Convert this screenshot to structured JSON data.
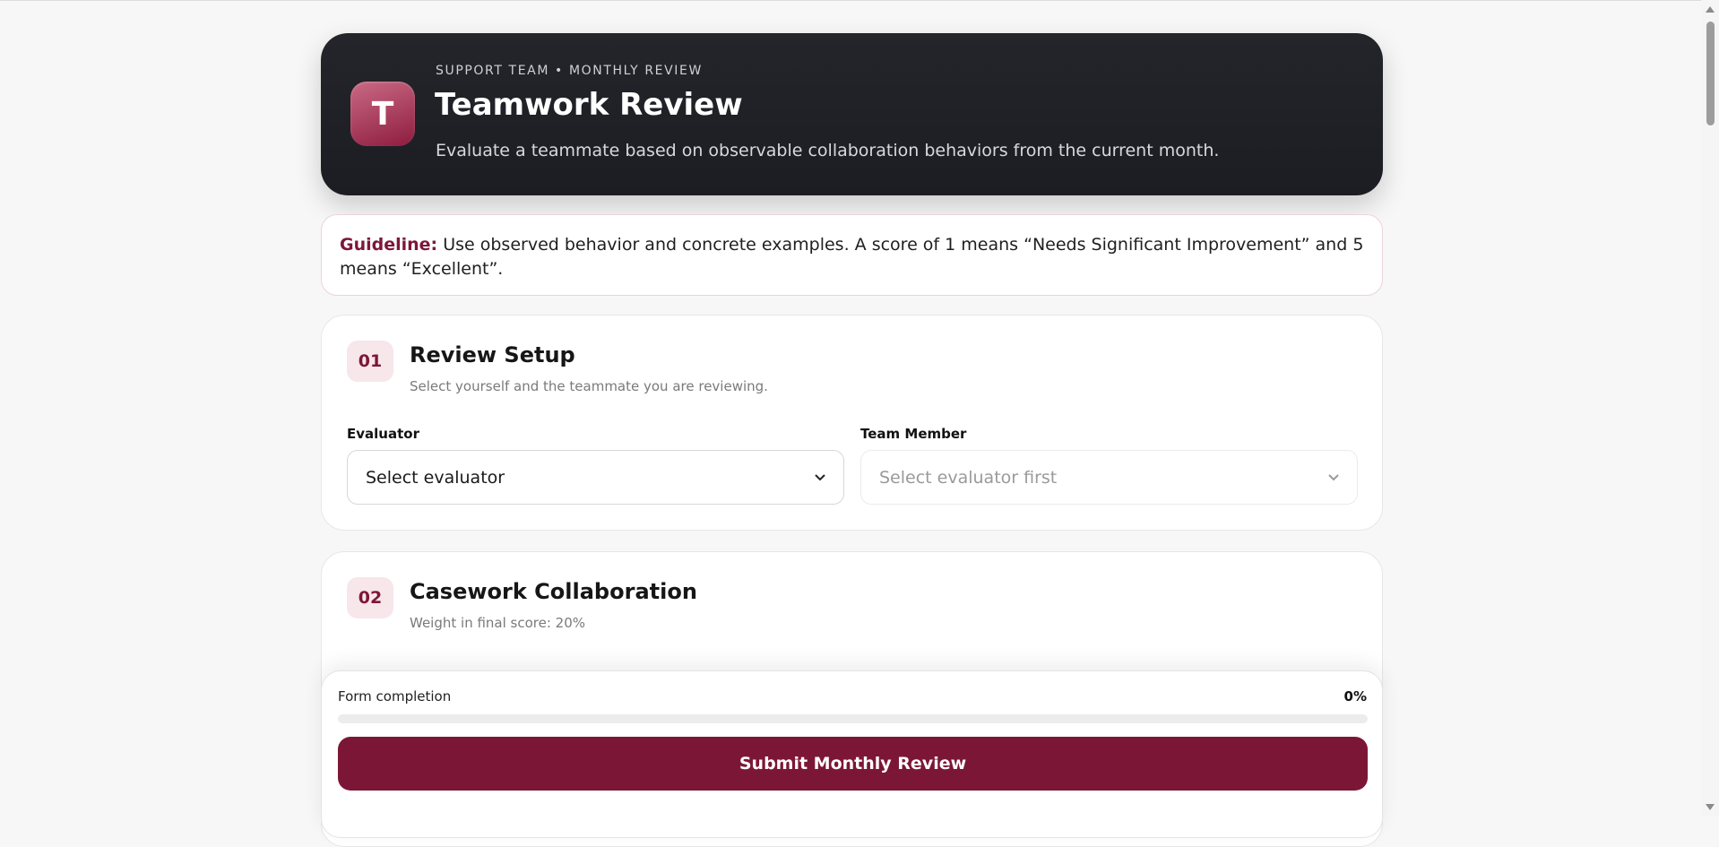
{
  "header": {
    "logo_letter": "T",
    "eyebrow": "SUPPORT TEAM • MONTHLY REVIEW",
    "title": "Teamwork Review",
    "description": "Evaluate a teammate based on observable collaboration behaviors from the current month."
  },
  "guideline": {
    "label": "Guideline:",
    "text": " Use observed behavior and concrete examples. A score of 1 means “Needs Significant Improvement” and 5 means “Excellent”."
  },
  "sections": [
    {
      "number": "01",
      "title": "Review Setup",
      "subtitle": "Select yourself and the teammate you are reviewing.",
      "fields": [
        {
          "label": "Evaluator",
          "selected": "Select evaluator",
          "disabled": false
        },
        {
          "label": "Team Member",
          "selected": "Select evaluator first",
          "disabled": true
        }
      ]
    },
    {
      "number": "02",
      "title": "Casework Collaboration",
      "subtitle": "Weight in final score: 20%"
    }
  ],
  "progress": {
    "label": "Form completion",
    "percent_text": "0%",
    "value": 0
  },
  "submit": {
    "label": "Submit Monthly Review"
  },
  "colors": {
    "accent": "#7c1637",
    "header_bg": "#1f2026",
    "badge_bg": "#f7e6ea"
  },
  "icons": {
    "select_chevron": "chevron-down-icon",
    "scroll_up": "scroll-up-arrow-icon",
    "scroll_down": "scroll-down-arrow-icon"
  }
}
